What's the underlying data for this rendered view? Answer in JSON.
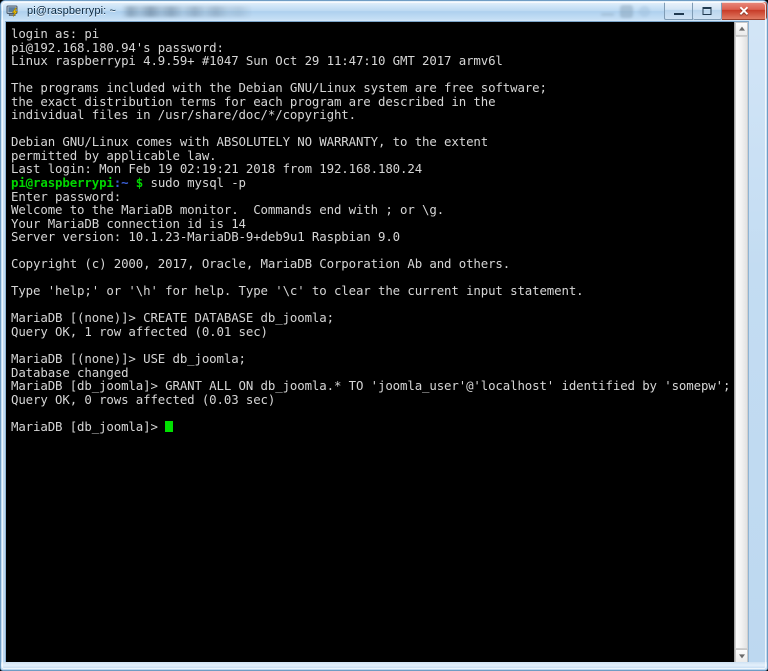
{
  "window": {
    "title": "pi@raspberrypi: ~",
    "icon": "putty-icon",
    "title_redacted": true,
    "controls": {
      "minimize_label": "─",
      "maximize_label": "□",
      "close_label": "✕"
    }
  },
  "scrollbar": {
    "up_label": "▲",
    "down_label": "▼"
  },
  "terminal": {
    "colors": {
      "background": "#000000",
      "foreground": "#d6d6d6",
      "prompt_user_host": "#00d700",
      "prompt_path": "#3b5fd6",
      "cursor": "#00e000"
    },
    "lines": [
      {
        "id": "l01",
        "text": "login as: pi"
      },
      {
        "id": "l02",
        "text": "pi@192.168.180.94's password:"
      },
      {
        "id": "l03",
        "text": "Linux raspberrypi 4.9.59+ #1047 Sun Oct 29 11:47:10 GMT 2017 armv6l"
      },
      {
        "id": "l04",
        "text": ""
      },
      {
        "id": "l05",
        "text": "The programs included with the Debian GNU/Linux system are free software;"
      },
      {
        "id": "l06",
        "text": "the exact distribution terms for each program are described in the"
      },
      {
        "id": "l07",
        "text": "individual files in /usr/share/doc/*/copyright."
      },
      {
        "id": "l08",
        "text": ""
      },
      {
        "id": "l09",
        "text": "Debian GNU/Linux comes with ABSOLUTELY NO WARRANTY, to the extent"
      },
      {
        "id": "l10",
        "text": "permitted by applicable law."
      },
      {
        "id": "l11",
        "text": "Last login: Mon Feb 19 02:19:21 2018 from 192.168.180.24"
      },
      {
        "id": "l12",
        "prompt": true,
        "user_host": "pi@raspberrypi",
        "path": ":~",
        "sigil": "$",
        "command": " sudo mysql -p"
      },
      {
        "id": "l13",
        "text": "Enter password:"
      },
      {
        "id": "l14",
        "text": "Welcome to the MariaDB monitor.  Commands end with ; or \\g."
      },
      {
        "id": "l15",
        "text": "Your MariaDB connection id is 14"
      },
      {
        "id": "l16",
        "text": "Server version: 10.1.23-MariaDB-9+deb9u1 Raspbian 9.0"
      },
      {
        "id": "l17",
        "text": ""
      },
      {
        "id": "l18",
        "text": "Copyright (c) 2000, 2017, Oracle, MariaDB Corporation Ab and others."
      },
      {
        "id": "l19",
        "text": ""
      },
      {
        "id": "l20",
        "text": "Type 'help;' or '\\h' for help. Type '\\c' to clear the current input statement."
      },
      {
        "id": "l21",
        "text": ""
      },
      {
        "id": "l22",
        "text": "MariaDB [(none)]> CREATE DATABASE db_joomla;"
      },
      {
        "id": "l23",
        "text": "Query OK, 1 row affected (0.01 sec)"
      },
      {
        "id": "l24",
        "text": ""
      },
      {
        "id": "l25",
        "text": "MariaDB [(none)]> USE db_joomla;"
      },
      {
        "id": "l26",
        "text": "Database changed"
      },
      {
        "id": "l27",
        "text": "MariaDB [db_joomla]> GRANT ALL ON db_joomla.* TO 'joomla_user'@'localhost' identified by 'somepw';"
      },
      {
        "id": "l28",
        "text": "Query OK, 0 rows affected (0.03 sec)"
      },
      {
        "id": "l29",
        "text": ""
      },
      {
        "id": "l30",
        "cursor_line": true,
        "text": "MariaDB [db_joomla]> "
      }
    ]
  }
}
